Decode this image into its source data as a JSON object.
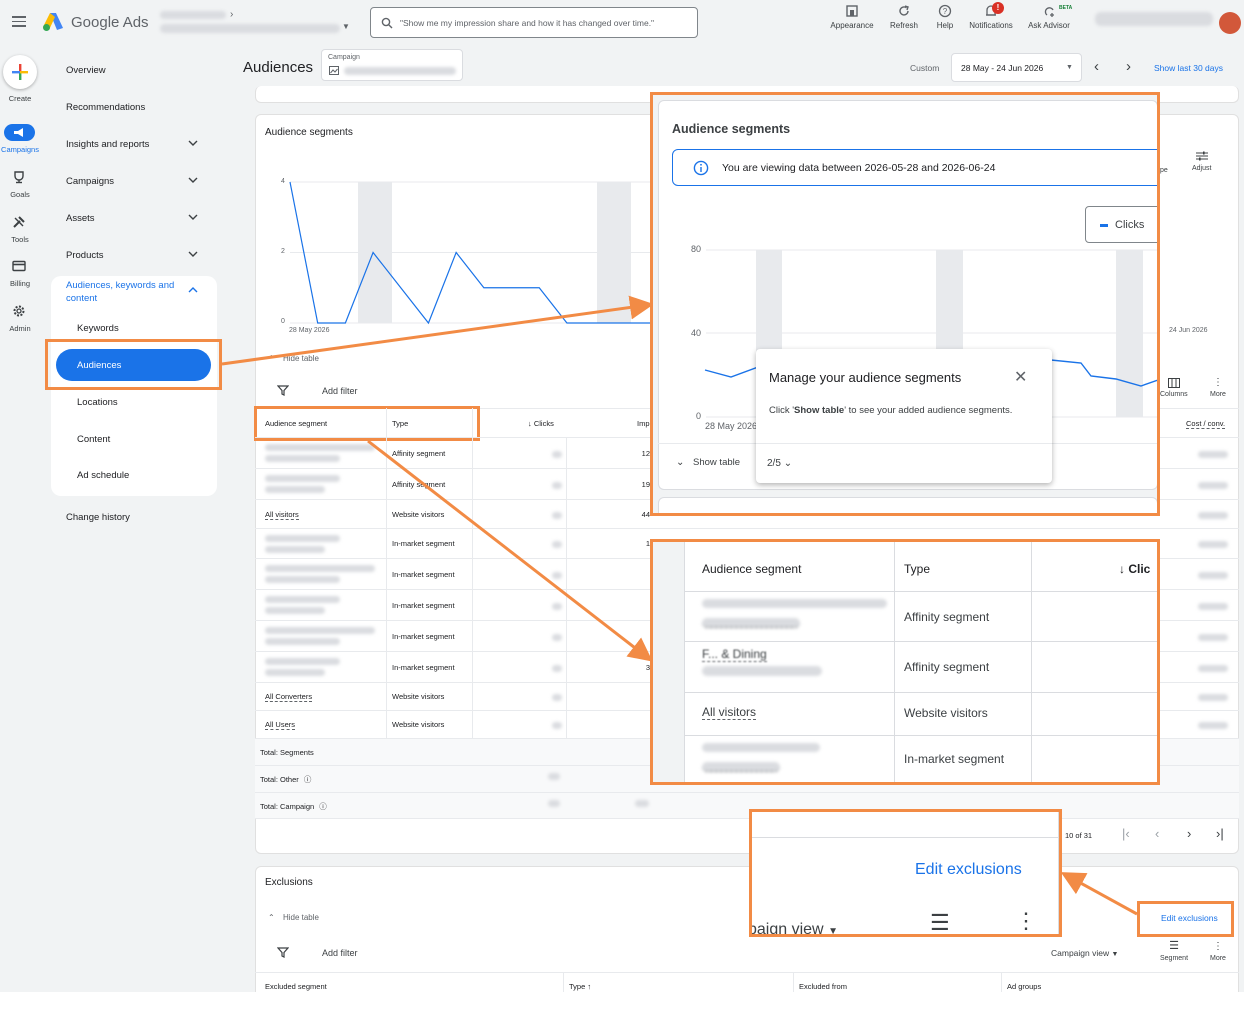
{
  "header": {
    "product_name": "Google Ads",
    "search_placeholder": "\"Show me my impression share and how it has changed over time.\"",
    "buttons": [
      {
        "label": "Appearance",
        "icon": "appearance-icon"
      },
      {
        "label": "Refresh",
        "icon": "refresh-icon"
      },
      {
        "label": "Help",
        "icon": "help-icon"
      },
      {
        "label": "Notifications",
        "icon": "bell-icon",
        "badge": "!"
      },
      {
        "label": "Ask Advisor",
        "icon": "advisor-icon",
        "tag": "BETA"
      }
    ]
  },
  "rail": {
    "create": "Create",
    "items": [
      "Campaigns",
      "Goals",
      "Tools",
      "Billing",
      "Admin"
    ]
  },
  "nav": {
    "overview": "Overview",
    "recommendations": "Recommendations",
    "insights": "Insights and reports",
    "campaigns": "Campaigns",
    "assets": "Assets",
    "products": "Products",
    "audiences_group": "Audiences, keywords and content",
    "keywords": "Keywords",
    "audiences": "Audiences",
    "locations": "Locations",
    "content": "Content",
    "ad_schedule": "Ad schedule",
    "change_history": "Change history"
  },
  "page": {
    "title": "Audiences",
    "campaign_label": "Campaign",
    "custom_label": "Custom",
    "date_range": "28 May - 24 Jun 2026",
    "show_last": "Show last 30 days"
  },
  "segments_card": {
    "title": "Audience segments",
    "y_ticks": [
      "4",
      "2",
      "0"
    ],
    "x_start": "28 May 2026",
    "x_end": "24 Jun 2026",
    "hide_table": "Hide table",
    "add_filter": "Add filter",
    "adjust": "Adjust",
    "type_partial": "pe",
    "columns": "Columns",
    "more": "More",
    "col_headers": {
      "segment": "Audience segment",
      "type": "Type",
      "clicks": "Clicks",
      "impr": "Imp",
      "cost_conv": "Cost / conv."
    },
    "rows": [
      {
        "segment": "",
        "type": "Affinity segment",
        "impr": "12"
      },
      {
        "segment": "F... & Dining",
        "type": "Affinity segment",
        "impr": "19"
      },
      {
        "segment": "All visitors",
        "type": "Website visitors",
        "impr": "44"
      },
      {
        "segment": "",
        "type": "In-market segment",
        "impr": "1"
      },
      {
        "segment": "",
        "type": "In-market segment",
        "impr": ""
      },
      {
        "segment": "",
        "type": "In-market segment",
        "impr": ""
      },
      {
        "segment": "",
        "type": "In-market segment",
        "impr": ""
      },
      {
        "segment": "",
        "type": "In-market segment",
        "impr": "3"
      },
      {
        "segment": "All Converters",
        "type": "Website visitors",
        "impr": ""
      },
      {
        "segment": "All Users",
        "type": "Website visitors",
        "impr": ""
      }
    ],
    "totals": [
      "Total: Segments",
      "Total: Other",
      "Total: Campaign"
    ],
    "pagination": "10 of 31"
  },
  "chart_data": {
    "type": "line",
    "series": [
      {
        "values": [
          4,
          0,
          0,
          2,
          1,
          0,
          2,
          1,
          1,
          1,
          0,
          0,
          0,
          0
        ]
      }
    ],
    "x_start": "28 May 2026",
    "x_end": "24 Jun 2026",
    "ylim": [
      0,
      4
    ],
    "y_ticks": [
      0,
      2,
      4
    ]
  },
  "zoom_top": {
    "title": "Audience segments",
    "info": "You are viewing data between 2026-05-28 and 2026-06-24",
    "metric": "Clicks",
    "y_ticks": [
      "80",
      "40",
      "0"
    ],
    "x_start": "28 May 2026",
    "tooltip_title": "Manage your audience segments",
    "tooltip_pre": "Click '",
    "tooltip_bold": "Show table",
    "tooltip_post": "' to see your added audience segments.",
    "show_table": "Show table",
    "step": "2/5"
  },
  "zoom_table": {
    "headers": {
      "segment": "Audience segment",
      "type": "Type",
      "clicks": "Clic"
    },
    "rows": [
      {
        "segment": "",
        "type": "Affinity segment"
      },
      {
        "segment": "F... & Dining",
        "type": "Affinity segment"
      },
      {
        "segment": "All visitors",
        "type": "Website visitors"
      },
      {
        "segment": "",
        "type": "In-market segment"
      }
    ]
  },
  "zoom_exclusions": {
    "edit": "Edit exclusions",
    "campaign_view_partial": "paign view"
  },
  "exclusions_card": {
    "title": "Exclusions",
    "hide_table": "Hide table",
    "add_filter": "Add filter",
    "edit": "Edit exclusions",
    "campaign_view": "Campaign view",
    "segment": "Segment",
    "more": "More",
    "headers": [
      "Excluded segment",
      "Type",
      "Excluded from",
      "Ad groups"
    ]
  },
  "colors": {
    "accent": "#1a73e8",
    "annotation": "#f28b45",
    "line": "#1a73e8"
  }
}
